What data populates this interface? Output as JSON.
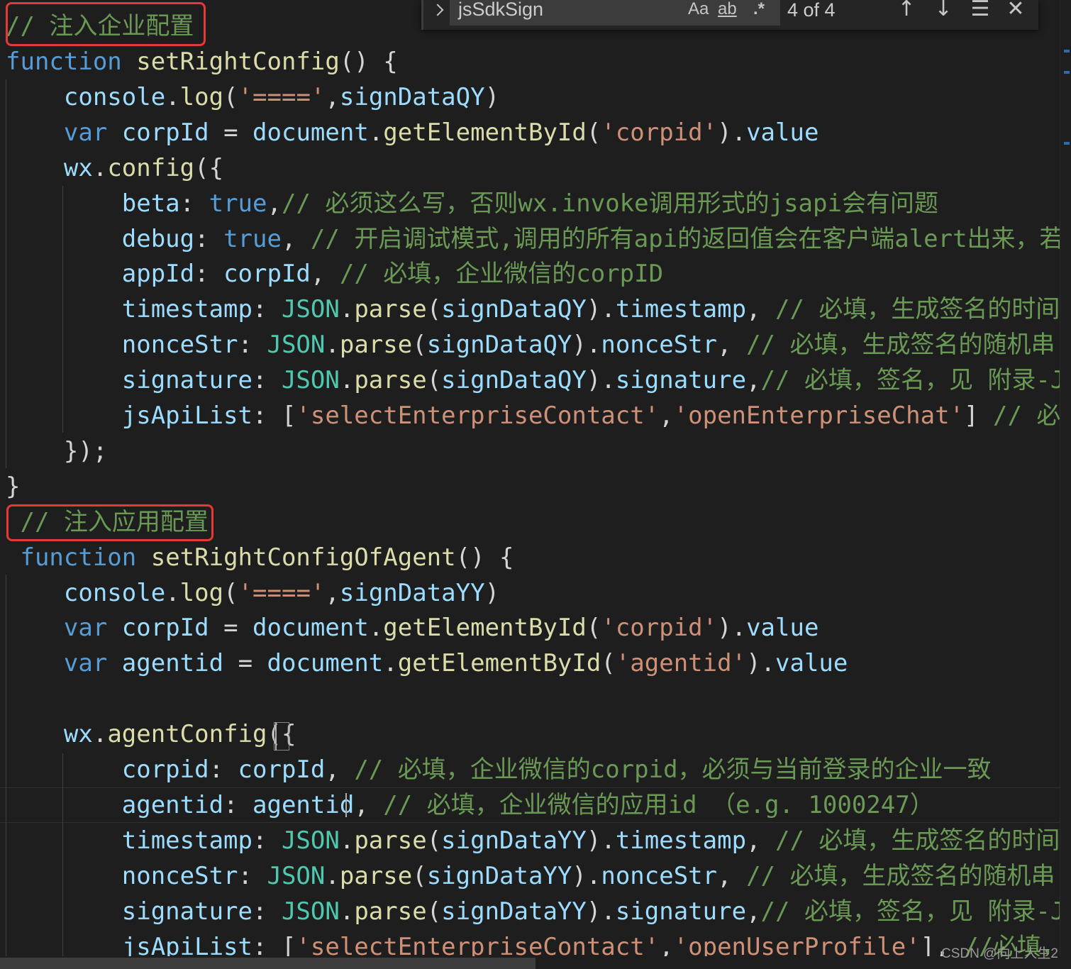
{
  "find_widget": {
    "query": "jsSdkSign",
    "match_case_label": "Aa",
    "whole_word_label": "ab",
    "regex_label": ".*",
    "result_count": "4 of 4"
  },
  "watermark": "CSDN @向上人生2",
  "lines": [
    [
      {
        "t": "// 注入企业配置",
        "c": "cmt"
      }
    ],
    [
      {
        "t": "function",
        "c": "kw"
      },
      {
        "t": " ",
        "c": "pun"
      },
      {
        "t": "setRightConfig",
        "c": "fn"
      },
      {
        "t": "() {",
        "c": "pun"
      }
    ],
    [
      {
        "t": "    ",
        "c": "pun"
      },
      {
        "t": "console",
        "c": "var"
      },
      {
        "t": ".",
        "c": "pun"
      },
      {
        "t": "log",
        "c": "fn"
      },
      {
        "t": "(",
        "c": "pun"
      },
      {
        "t": "'===='",
        "c": "str"
      },
      {
        "t": ",",
        "c": "pun"
      },
      {
        "t": "signDataQY",
        "c": "var"
      },
      {
        "t": ")",
        "c": "pun"
      }
    ],
    [
      {
        "t": "    ",
        "c": "pun"
      },
      {
        "t": "var",
        "c": "kw"
      },
      {
        "t": " ",
        "c": "pun"
      },
      {
        "t": "corpId",
        "c": "var"
      },
      {
        "t": " = ",
        "c": "pun"
      },
      {
        "t": "document",
        "c": "var"
      },
      {
        "t": ".",
        "c": "pun"
      },
      {
        "t": "getElementById",
        "c": "fn"
      },
      {
        "t": "(",
        "c": "pun"
      },
      {
        "t": "'corpid'",
        "c": "str"
      },
      {
        "t": ").",
        "c": "pun"
      },
      {
        "t": "value",
        "c": "var"
      }
    ],
    [
      {
        "t": "    ",
        "c": "pun"
      },
      {
        "t": "wx",
        "c": "var"
      },
      {
        "t": ".",
        "c": "pun"
      },
      {
        "t": "config",
        "c": "fn"
      },
      {
        "t": "({",
        "c": "pun"
      }
    ],
    [
      {
        "t": "        ",
        "c": "pun"
      },
      {
        "t": "beta",
        "c": "var"
      },
      {
        "t": ": ",
        "c": "pun"
      },
      {
        "t": "true",
        "c": "kw"
      },
      {
        "t": ",",
        "c": "pun"
      },
      {
        "t": "// 必须这么写，否则wx.invoke调用形式的jsapi会有问题",
        "c": "cmt"
      }
    ],
    [
      {
        "t": "        ",
        "c": "pun"
      },
      {
        "t": "debug",
        "c": "var"
      },
      {
        "t": ": ",
        "c": "pun"
      },
      {
        "t": "true",
        "c": "kw"
      },
      {
        "t": ", ",
        "c": "pun"
      },
      {
        "t": "// 开启调试模式,调用的所有api的返回值会在客户端alert出来，若要",
        "c": "cmt"
      }
    ],
    [
      {
        "t": "        ",
        "c": "pun"
      },
      {
        "t": "appId",
        "c": "var"
      },
      {
        "t": ": ",
        "c": "pun"
      },
      {
        "t": "corpId",
        "c": "var"
      },
      {
        "t": ", ",
        "c": "pun"
      },
      {
        "t": "// 必填，企业微信的corpID",
        "c": "cmt"
      }
    ],
    [
      {
        "t": "        ",
        "c": "pun"
      },
      {
        "t": "timestamp",
        "c": "var"
      },
      {
        "t": ": ",
        "c": "pun"
      },
      {
        "t": "JSON",
        "c": "cls"
      },
      {
        "t": ".",
        "c": "pun"
      },
      {
        "t": "parse",
        "c": "fn"
      },
      {
        "t": "(",
        "c": "pun"
      },
      {
        "t": "signDataQY",
        "c": "var"
      },
      {
        "t": ").",
        "c": "pun"
      },
      {
        "t": "timestamp",
        "c": "var"
      },
      {
        "t": ", ",
        "c": "pun"
      },
      {
        "t": "// 必填，生成签名的时间戳",
        "c": "cmt"
      }
    ],
    [
      {
        "t": "        ",
        "c": "pun"
      },
      {
        "t": "nonceStr",
        "c": "var"
      },
      {
        "t": ": ",
        "c": "pun"
      },
      {
        "t": "JSON",
        "c": "cls"
      },
      {
        "t": ".",
        "c": "pun"
      },
      {
        "t": "parse",
        "c": "fn"
      },
      {
        "t": "(",
        "c": "pun"
      },
      {
        "t": "signDataQY",
        "c": "var"
      },
      {
        "t": ").",
        "c": "pun"
      },
      {
        "t": "nonceStr",
        "c": "var"
      },
      {
        "t": ", ",
        "c": "pun"
      },
      {
        "t": "// 必填，生成签名的随机串",
        "c": "cmt"
      }
    ],
    [
      {
        "t": "        ",
        "c": "pun"
      },
      {
        "t": "signature",
        "c": "var"
      },
      {
        "t": ": ",
        "c": "pun"
      },
      {
        "t": "JSON",
        "c": "cls"
      },
      {
        "t": ".",
        "c": "pun"
      },
      {
        "t": "parse",
        "c": "fn"
      },
      {
        "t": "(",
        "c": "pun"
      },
      {
        "t": "signDataQY",
        "c": "var"
      },
      {
        "t": ").",
        "c": "pun"
      },
      {
        "t": "signature",
        "c": "var"
      },
      {
        "t": ",",
        "c": "pun"
      },
      {
        "t": "// 必填，签名，见 附录-JS-",
        "c": "cmt"
      }
    ],
    [
      {
        "t": "        ",
        "c": "pun"
      },
      {
        "t": "jsApiList",
        "c": "var"
      },
      {
        "t": ": [",
        "c": "pun"
      },
      {
        "t": "'selectEnterpriseContact'",
        "c": "str"
      },
      {
        "t": ",",
        "c": "pun"
      },
      {
        "t": "'openEnterpriseChat'",
        "c": "str"
      },
      {
        "t": "] ",
        "c": "pun"
      },
      {
        "t": "// 必填",
        "c": "cmt"
      }
    ],
    [
      {
        "t": "    });",
        "c": "pun"
      }
    ],
    [
      {
        "t": "}",
        "c": "pun"
      }
    ],
    [
      {
        "t": " // 注入应用配置",
        "c": "cmt"
      }
    ],
    [
      {
        "t": " ",
        "c": "pun"
      },
      {
        "t": "function",
        "c": "kw"
      },
      {
        "t": " ",
        "c": "pun"
      },
      {
        "t": "setRightConfigOfAgent",
        "c": "fn"
      },
      {
        "t": "() {",
        "c": "pun"
      }
    ],
    [
      {
        "t": "    ",
        "c": "pun"
      },
      {
        "t": "console",
        "c": "var"
      },
      {
        "t": ".",
        "c": "pun"
      },
      {
        "t": "log",
        "c": "fn"
      },
      {
        "t": "(",
        "c": "pun"
      },
      {
        "t": "'===='",
        "c": "str"
      },
      {
        "t": ",",
        "c": "pun"
      },
      {
        "t": "signDataYY",
        "c": "var"
      },
      {
        "t": ")",
        "c": "pun"
      }
    ],
    [
      {
        "t": "    ",
        "c": "pun"
      },
      {
        "t": "var",
        "c": "kw"
      },
      {
        "t": " ",
        "c": "pun"
      },
      {
        "t": "corpId",
        "c": "var"
      },
      {
        "t": " = ",
        "c": "pun"
      },
      {
        "t": "document",
        "c": "var"
      },
      {
        "t": ".",
        "c": "pun"
      },
      {
        "t": "getElementById",
        "c": "fn"
      },
      {
        "t": "(",
        "c": "pun"
      },
      {
        "t": "'corpid'",
        "c": "str"
      },
      {
        "t": ").",
        "c": "pun"
      },
      {
        "t": "value",
        "c": "var"
      }
    ],
    [
      {
        "t": "    ",
        "c": "pun"
      },
      {
        "t": "var",
        "c": "kw"
      },
      {
        "t": " ",
        "c": "pun"
      },
      {
        "t": "agentid",
        "c": "var"
      },
      {
        "t": " = ",
        "c": "pun"
      },
      {
        "t": "document",
        "c": "var"
      },
      {
        "t": ".",
        "c": "pun"
      },
      {
        "t": "getElementById",
        "c": "fn"
      },
      {
        "t": "(",
        "c": "pun"
      },
      {
        "t": "'agentid'",
        "c": "str"
      },
      {
        "t": ").",
        "c": "pun"
      },
      {
        "t": "value",
        "c": "var"
      }
    ],
    [],
    [
      {
        "t": "    ",
        "c": "pun"
      },
      {
        "t": "wx",
        "c": "var"
      },
      {
        "t": ".",
        "c": "pun"
      },
      {
        "t": "agentConfig",
        "c": "fn"
      },
      {
        "t": "({",
        "c": "pun"
      }
    ],
    [
      {
        "t": "        ",
        "c": "pun"
      },
      {
        "t": "corpid",
        "c": "var"
      },
      {
        "t": ": ",
        "c": "pun"
      },
      {
        "t": "corpId",
        "c": "var"
      },
      {
        "t": ", ",
        "c": "pun"
      },
      {
        "t": "// 必填，企业微信的corpid，必须与当前登录的企业一致",
        "c": "cmt"
      }
    ],
    [
      {
        "t": "        ",
        "c": "pun"
      },
      {
        "t": "agentid",
        "c": "var"
      },
      {
        "t": ": ",
        "c": "pun"
      },
      {
        "t": "agentid",
        "c": "var"
      },
      {
        "t": ", ",
        "c": "pun"
      },
      {
        "t": "// 必填，企业微信的应用id （e.g. 1000247）",
        "c": "cmt"
      }
    ],
    [
      {
        "t": "        ",
        "c": "pun"
      },
      {
        "t": "timestamp",
        "c": "var"
      },
      {
        "t": ": ",
        "c": "pun"
      },
      {
        "t": "JSON",
        "c": "cls"
      },
      {
        "t": ".",
        "c": "pun"
      },
      {
        "t": "parse",
        "c": "fn"
      },
      {
        "t": "(",
        "c": "pun"
      },
      {
        "t": "signDataYY",
        "c": "var"
      },
      {
        "t": ").",
        "c": "pun"
      },
      {
        "t": "timestamp",
        "c": "var"
      },
      {
        "t": ", ",
        "c": "pun"
      },
      {
        "t": "// 必填，生成签名的时间戳",
        "c": "cmt"
      }
    ],
    [
      {
        "t": "        ",
        "c": "pun"
      },
      {
        "t": "nonceStr",
        "c": "var"
      },
      {
        "t": ": ",
        "c": "pun"
      },
      {
        "t": "JSON",
        "c": "cls"
      },
      {
        "t": ".",
        "c": "pun"
      },
      {
        "t": "parse",
        "c": "fn"
      },
      {
        "t": "(",
        "c": "pun"
      },
      {
        "t": "signDataYY",
        "c": "var"
      },
      {
        "t": ").",
        "c": "pun"
      },
      {
        "t": "nonceStr",
        "c": "var"
      },
      {
        "t": ", ",
        "c": "pun"
      },
      {
        "t": "// 必填，生成签名的随机串",
        "c": "cmt"
      }
    ],
    [
      {
        "t": "        ",
        "c": "pun"
      },
      {
        "t": "signature",
        "c": "var"
      },
      {
        "t": ": ",
        "c": "pun"
      },
      {
        "t": "JSON",
        "c": "cls"
      },
      {
        "t": ".",
        "c": "pun"
      },
      {
        "t": "parse",
        "c": "fn"
      },
      {
        "t": "(",
        "c": "pun"
      },
      {
        "t": "signDataYY",
        "c": "var"
      },
      {
        "t": ").",
        "c": "pun"
      },
      {
        "t": "signature",
        "c": "var"
      },
      {
        "t": ",",
        "c": "pun"
      },
      {
        "t": "// 必填，签名，见 附录-JS-",
        "c": "cmt"
      }
    ],
    [
      {
        "t": "        ",
        "c": "pun"
      },
      {
        "t": "jsApiList",
        "c": "var"
      },
      {
        "t": ": [",
        "c": "pun"
      },
      {
        "t": "'selectEnterpriseContact'",
        "c": "str"
      },
      {
        "t": ",",
        "c": "pun"
      },
      {
        "t": "'openUserProfile'",
        "c": "str"
      },
      {
        "t": "], ",
        "c": "pun"
      },
      {
        "t": "//必填，传",
        "c": "cmt"
      }
    ]
  ]
}
